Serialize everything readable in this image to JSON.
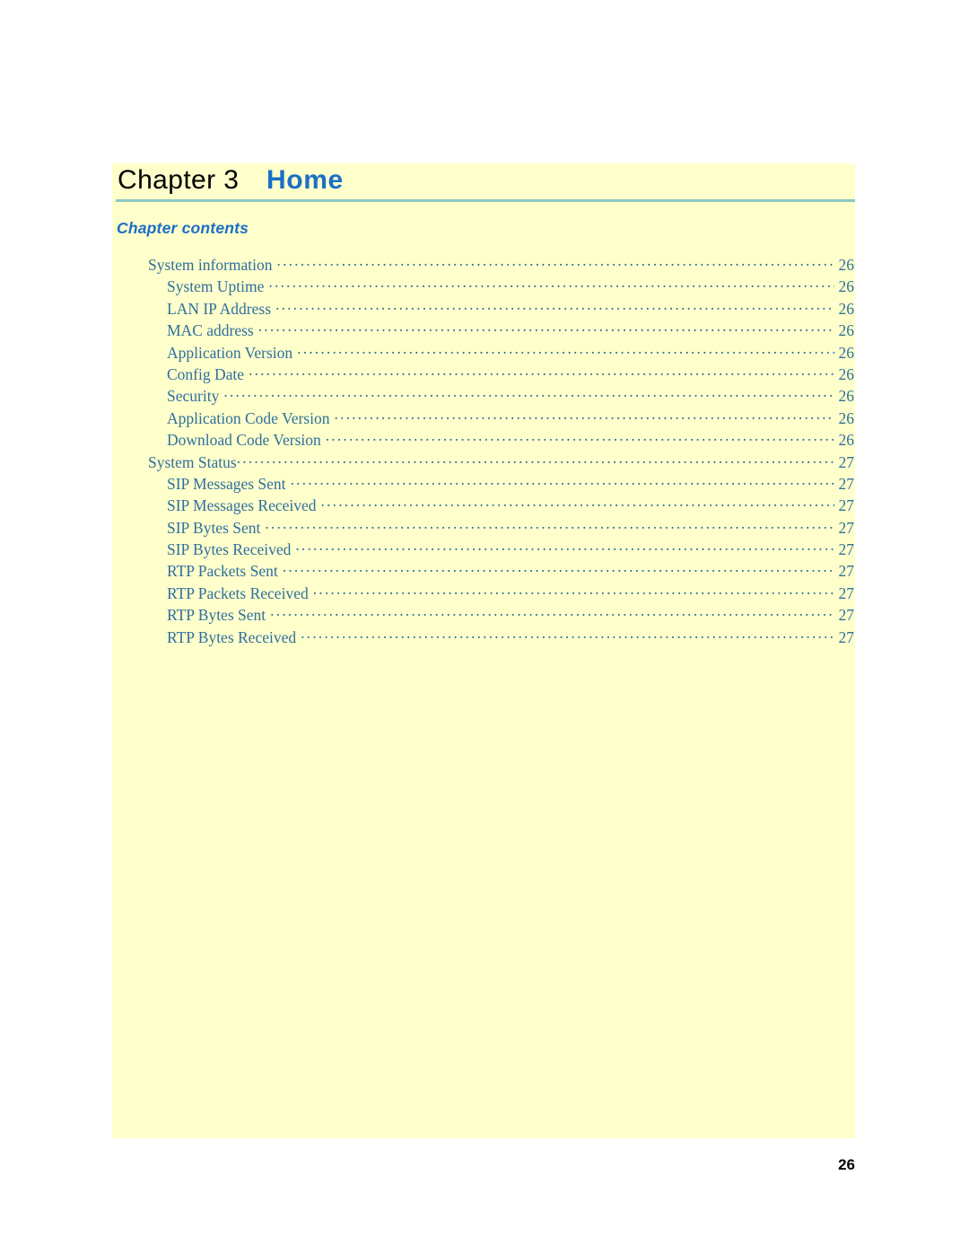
{
  "document": {
    "chapter_label": "Chapter 3",
    "chapter_title": "Home",
    "contents_heading": "Chapter contents",
    "footer_page_number": "26"
  },
  "colors": {
    "page_background": "#ffffff",
    "content_background": "#ffffcc",
    "rule": "#8fc6c4",
    "heading_blue": "#1b6fc6",
    "toc_text": "#2f6f9e",
    "chapter_label_black": "#000000"
  },
  "toc": {
    "entries": [
      {
        "label": "System information",
        "page": "26",
        "level": 1,
        "gap": true
      },
      {
        "label": "System Uptime",
        "page": "26",
        "level": 2,
        "gap": true
      },
      {
        "label": "LAN IP Address",
        "page": "26",
        "level": 2,
        "gap": true
      },
      {
        "label": "MAC address",
        "page": "26",
        "level": 2,
        "gap": true
      },
      {
        "label": "Application Version",
        "page": "26",
        "level": 2,
        "gap": true
      },
      {
        "label": "Config Date",
        "page": "26",
        "level": 2,
        "gap": true
      },
      {
        "label": "Security",
        "page": "26",
        "level": 2,
        "gap": true
      },
      {
        "label": "Application Code Version",
        "page": "26",
        "level": 2,
        "gap": true
      },
      {
        "label": "Download Code Version",
        "page": "26",
        "level": 2,
        "gap": true
      },
      {
        "label": "System Status",
        "page": "27",
        "level": 1,
        "gap": false
      },
      {
        "label": "SIP Messages Sent",
        "page": "27",
        "level": 2,
        "gap": true
      },
      {
        "label": "SIP Messages Received",
        "page": "27",
        "level": 2,
        "gap": true
      },
      {
        "label": "SIP Bytes Sent",
        "page": "27",
        "level": 2,
        "gap": true
      },
      {
        "label": "SIP Bytes Received",
        "page": "27",
        "level": 2,
        "gap": true
      },
      {
        "label": "RTP Packets Sent",
        "page": "27",
        "level": 2,
        "gap": true
      },
      {
        "label": "RTP Packets Received",
        "page": "27",
        "level": 2,
        "gap": true
      },
      {
        "label": "RTP Bytes Sent",
        "page": "27",
        "level": 2,
        "gap": true
      },
      {
        "label": "RTP Bytes Received",
        "page": "27",
        "level": 2,
        "gap": true
      }
    ]
  }
}
